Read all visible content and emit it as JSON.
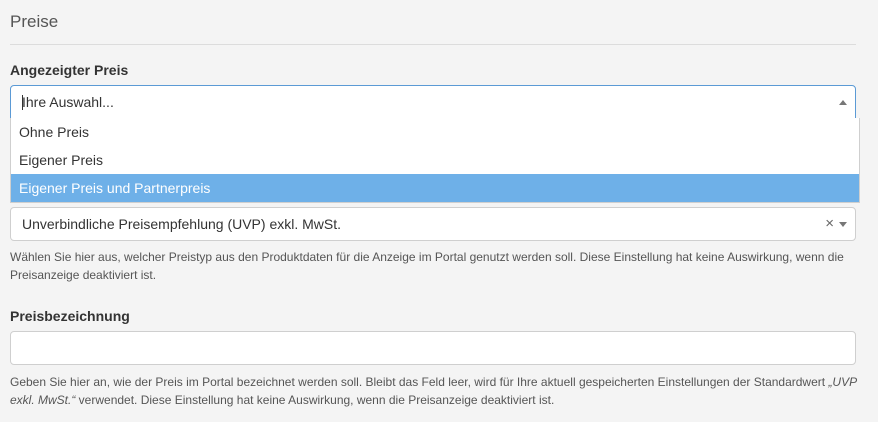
{
  "section": {
    "title": "Preise"
  },
  "displayed_price": {
    "label": "Angezeigter Preis",
    "placeholder": "Ihre Auswahl...",
    "options": [
      {
        "label": "Ohne Preis",
        "highlighted": false
      },
      {
        "label": "Eigener Preis",
        "highlighted": false
      },
      {
        "label": "Eigener Preis und Partnerpreis",
        "highlighted": true
      }
    ]
  },
  "price_type": {
    "selected_value": "Unverbindliche Preisempfehlung (UVP) exkl. MwSt.",
    "clear_glyph": "×",
    "help_text": "Wählen Sie hier aus, welcher Preistyp aus den Produktdaten für die Anzeige im Portal genutzt werden soll. Diese Einstellung hat keine Auswirkung, wenn die Preisanzeige deaktiviert ist."
  },
  "price_label": {
    "label": "Preisbezeichnung",
    "value": "",
    "help_text_before": "Geben Sie hier an, wie der Preis im Portal bezeichnet werden soll. Bleibt das Feld leer, wird für Ihre aktuell gespeicherten Einstellungen der Standardwert ",
    "help_text_default": "„UVP exkl. MwSt.“",
    "help_text_after": " verwendet. Diese Einstellung hat keine Auswirkung, wenn die Preisanzeige deaktiviert ist."
  },
  "colors": {
    "background": "#f4f4f4",
    "focus_border": "#5b9ad5",
    "highlight": "#6eb0e8"
  }
}
